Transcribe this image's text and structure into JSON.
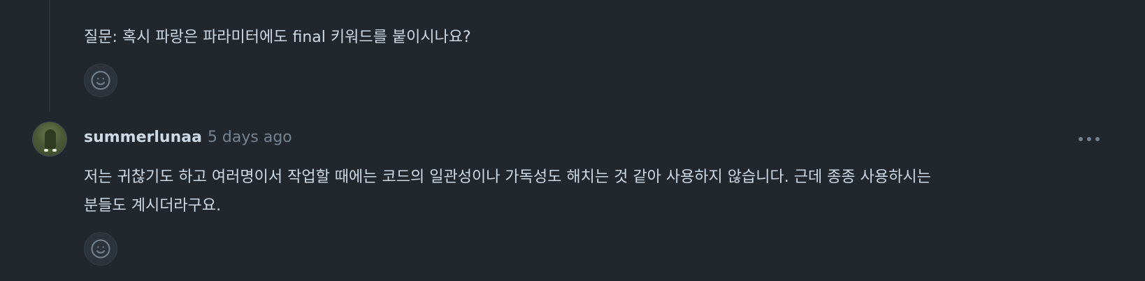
{
  "previous_comment": {
    "text": "질문: 혹시 파랑은 파라미터에도 final 키워드를 붙이시나요?",
    "reaction_icon": "smiley-icon"
  },
  "comment": {
    "author": "summerlunaa",
    "timestamp": "5 days ago",
    "body_line1": "저는 귀찮기도 하고 여러명이서 작업할 때에는 코드의 일관성이나 가독성도 해치는 것 같아 사용하지 않습니다. 근데 종종 사용하시는",
    "body_line2": "분들도 계시더라구요.",
    "more_icon": "kebab-horizontal-icon",
    "reaction_icon": "smiley-icon"
  },
  "colors": {
    "background": "#22272e",
    "text": "#cdd9e5",
    "muted": "#768390",
    "border": "#373e47"
  }
}
